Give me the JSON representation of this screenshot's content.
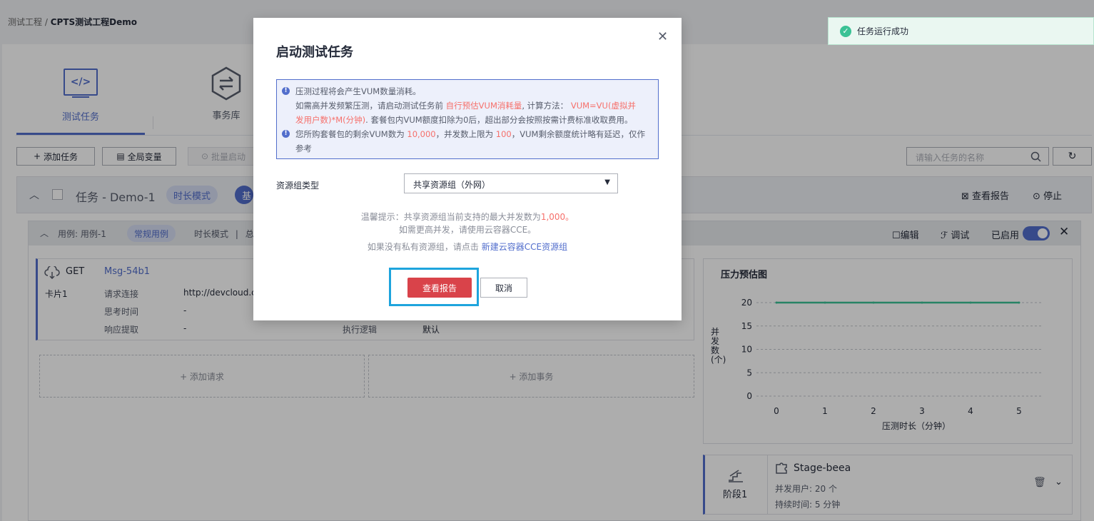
{
  "breadcrumb": {
    "root": "测试工程",
    "sep": "/",
    "current": "CPTS测试工程Demo"
  },
  "tabs": [
    {
      "label": "测试任务",
      "icon": "code-icon",
      "active": true
    },
    {
      "label": "事务库",
      "icon": "transaction-hex-icon",
      "active": false
    }
  ],
  "toolbar": {
    "add_task": "添加任务",
    "global_vars": "全局变量",
    "batch_start": "批量启动",
    "search_placeholder": "请输入任务的名称"
  },
  "task": {
    "name": "任务 - Demo-1",
    "mode": "时长模式",
    "tag2": "基",
    "view_report": "查看报告",
    "stop": "停止"
  },
  "case": {
    "name": "用例: 用例-1",
    "type": "常规用例",
    "mode": "时长模式",
    "sep": "|",
    "extra": "总",
    "edit": "编辑",
    "debug": "调试",
    "enabled": "已启用"
  },
  "request": {
    "method": "GET",
    "name": "Msg-54b1",
    "card": "卡片1",
    "rows": [
      {
        "label": "请求连接",
        "value": "http://devcloud.co"
      },
      {
        "label": "思考时间",
        "value": "-"
      },
      {
        "label": "响应提取",
        "value": "-"
      }
    ],
    "logic_label": "执行逻辑",
    "logic_value": "默认"
  },
  "add_request": "+ 添加请求",
  "add_transaction": "+ 添加事务",
  "chart_data": {
    "type": "line",
    "title": "压力预估图",
    "xlabel": "压测时长（分钟）",
    "ylabel": "并发数(个)",
    "x": [
      0,
      1,
      2,
      3,
      4,
      5
    ],
    "series": [
      {
        "values": [
          20,
          20,
          20,
          20,
          20,
          20
        ]
      }
    ],
    "yticks": [
      0,
      5,
      10,
      15,
      20
    ],
    "xlim": [
      0,
      5
    ],
    "ylim": [
      0,
      20
    ],
    "color": "#3ac295",
    "grid": true
  },
  "stage": {
    "label": "阶段1",
    "name": "Stage-beea",
    "users": "并发用户: 20 个",
    "duration": "持续时间: 5 分钟"
  },
  "toast": {
    "text": "任务运行成功",
    "color": "#3ac295"
  },
  "modal": {
    "title": "启动测试任务",
    "info": {
      "l1": "压测过程将会产生VUM数量消耗。",
      "l2a": "如需高并发频繁压测，请启动测试任务前 ",
      "l2b": "自行预估VUM消耗量",
      "l2c": ", 计算方法： ",
      "l2d": "VUM=VU(虚拟并",
      "l3a": "发用户数)*M(分钟)",
      "l3b": ". 套餐包内VUM额度扣除为0后，超出部分会按照按需计费标准收取费用。",
      "l4a": "您所购套餐包的剩余VUM数为 ",
      "l4b": "10,000",
      "l4c": "，并发数上限为 ",
      "l4d": "100",
      "l4e": "，VUM剩余额度统计略有延迟，仅作",
      "l5": "参考"
    },
    "resource_label": "资源组类型",
    "resource_value": "共享资源组（外网）",
    "tip1a": "温馨提示：共享资源组当前支持的最大并发数为",
    "tip1b": "1,000",
    "tip1c": "。",
    "tip2": "如需更高并发，请使用云容器CCE。",
    "tip3a": "如果没有私有资源组，请点击 ",
    "tip3b": "新建云容器CCE资源组",
    "confirm": "查看报告",
    "cancel": "取消"
  }
}
